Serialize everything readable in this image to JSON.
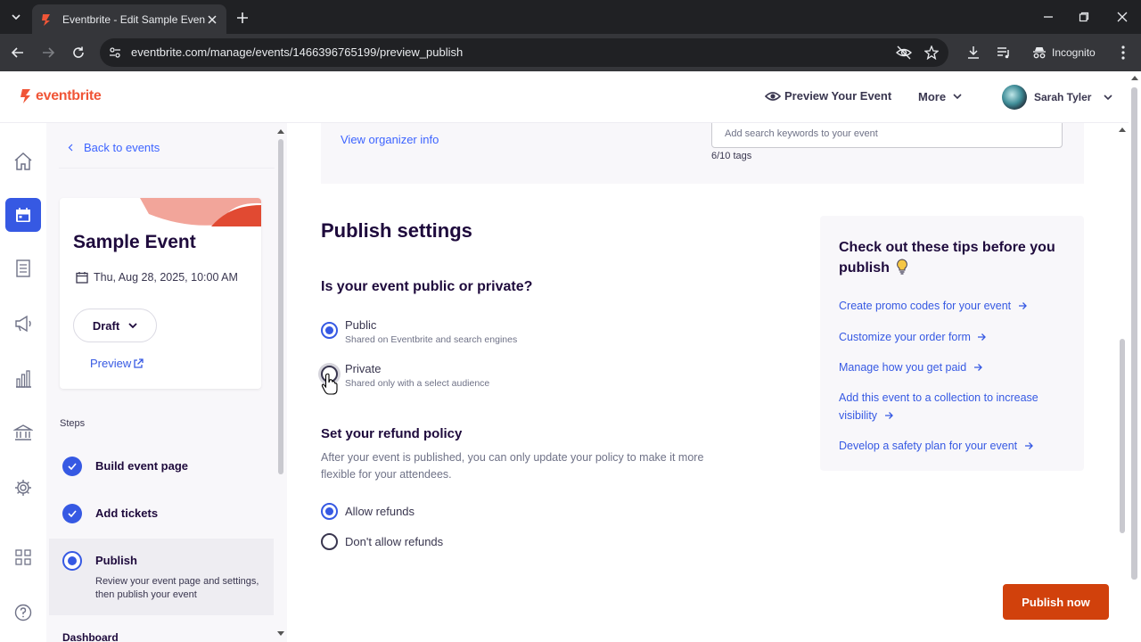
{
  "browser": {
    "tab_title": "Eventbrite - Edit Sample Event",
    "url": "eventbrite.com/manage/events/1466396765199/preview_publish",
    "incognito_label": "Incognito"
  },
  "header": {
    "logo_text": "eventbrite",
    "preview_label": "Preview Your Event",
    "more_label": "More",
    "user_name": "Sarah Tyler"
  },
  "sidebar": {
    "back_label": "Back to events",
    "event_name": "Sample Event",
    "event_date": "Thu, Aug 28, 2025, 10:00 AM",
    "status": "Draft",
    "preview_link": "Preview",
    "steps_label": "Steps",
    "steps": [
      {
        "label": "Build event page",
        "state": "done"
      },
      {
        "label": "Add tickets",
        "state": "done"
      },
      {
        "label": "Publish",
        "state": "current",
        "desc": "Review your event page and settings, then publish your event"
      }
    ],
    "dashboard_label": "Dashboard"
  },
  "main": {
    "view_organizer": "View organizer info",
    "keywords_placeholder": "Add search keywords to your event",
    "tags_count": "6/10 tags",
    "publish_title": "Publish settings",
    "visibility_question": "Is your event public or private?",
    "visibility_options": [
      {
        "label": "Public",
        "sub": "Shared on Eventbrite and search engines",
        "checked": true
      },
      {
        "label": "Private",
        "sub": "Shared only with a select audience",
        "checked": false
      }
    ],
    "refund_title": "Set your refund policy",
    "refund_desc": "After your event is published, you can only update your policy to make it more flexible for your attendees.",
    "refund_options": [
      {
        "label": "Allow refunds",
        "checked": true
      },
      {
        "label": "Don't allow refunds",
        "checked": false
      }
    ],
    "publish_button": "Publish now"
  },
  "tips": {
    "title": "Check out these tips before you publish",
    "links": [
      "Create promo codes for your event",
      "Customize your order form",
      "Manage how you get paid",
      "Add this event to a collection to increase visibility",
      "Develop a safety plan for your event"
    ]
  },
  "colors": {
    "brand": "#f05537",
    "accent": "#3659e3",
    "publish": "#d1410c"
  }
}
